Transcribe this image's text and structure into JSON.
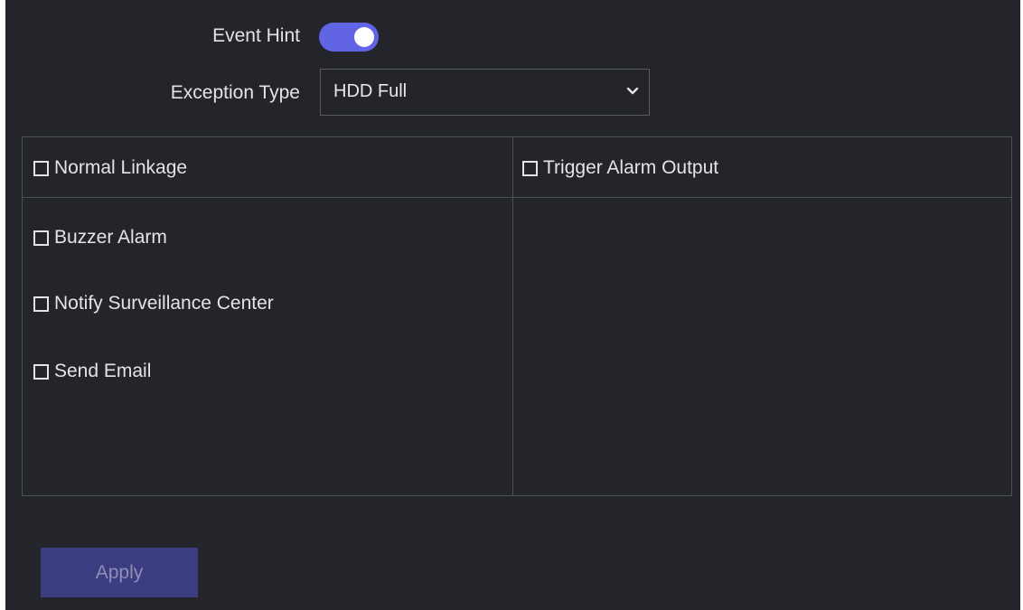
{
  "form": {
    "event_hint_label": "Event Hint",
    "event_hint_enabled": true,
    "exception_type_label": "Exception Type",
    "exception_type_value": "HDD Full"
  },
  "linkage": {
    "normal_linkage": "Normal Linkage",
    "trigger_alarm_output": "Trigger Alarm Output",
    "items": [
      {
        "label": "Buzzer Alarm",
        "checked": false
      },
      {
        "label": "Notify Surveillance Center",
        "checked": false
      },
      {
        "label": "Send Email",
        "checked": false
      }
    ]
  },
  "actions": {
    "apply_label": "Apply"
  },
  "colors": {
    "background": "#24252b",
    "accent": "#6264e6",
    "apply_button": "#3c3d80"
  },
  "icons": {
    "dropdown": "chevron-down-icon",
    "checkbox": "checkbox-icon"
  }
}
